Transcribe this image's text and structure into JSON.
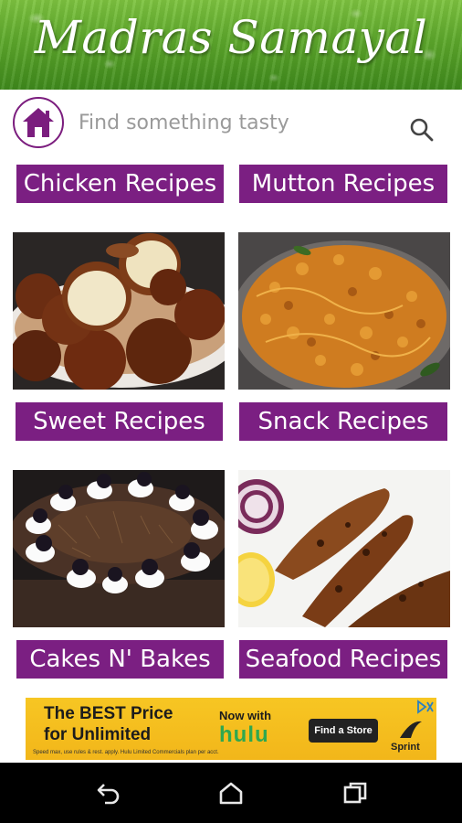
{
  "app": {
    "title": "Madras Samayal"
  },
  "search": {
    "placeholder": "Find something tasty"
  },
  "categories": [
    {
      "label": "Chicken Recipes"
    },
    {
      "label": "Mutton Recipes"
    },
    {
      "label": "Sweet Recipes"
    },
    {
      "label": "Snack Recipes"
    },
    {
      "label": "Cakes N' Bakes"
    },
    {
      "label": "Seafood Recipes"
    }
  ],
  "ad": {
    "headline_line1": "The BEST Price",
    "headline_line2": "for Unlimited",
    "now_with": "Now with",
    "brand": "hulu",
    "cta": "Find a Store",
    "sponsor": "Sprint",
    "fine_print": "Speed max, use rules & rest. apply. Hulu Limited Commercials plan per acct."
  },
  "icons": {
    "home": "home-icon",
    "search": "search-icon",
    "back": "back-icon",
    "nav_home": "nav-home-icon",
    "recents": "recents-icon",
    "ad_choices": "ad-choices-icon"
  },
  "colors": {
    "accent": "#7b1f82",
    "banner_green": "#5ea92c",
    "ad_yellow": "#f7c623"
  }
}
